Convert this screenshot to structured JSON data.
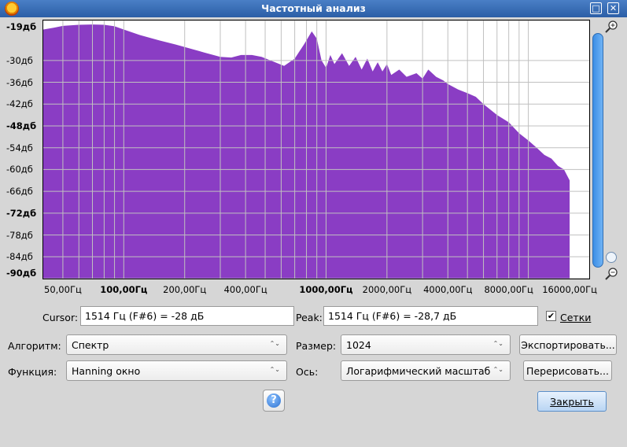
{
  "window": {
    "title": "Частотный анализ",
    "maximize_glyph": "□",
    "close_glyph": "✕"
  },
  "chart_data": {
    "type": "area",
    "title": "",
    "xlabel": "",
    "ylabel": "",
    "x_scale": "log",
    "xlim": [
      40,
      20000
    ],
    "ylim": [
      -90,
      -19
    ],
    "grid": true,
    "fill_color": "#8a3dc4",
    "x_ticks": [
      {
        "value": 50,
        "label": "50,00Гц",
        "bold": false
      },
      {
        "value": 100,
        "label": "100,00Гц",
        "bold": true
      },
      {
        "value": 200,
        "label": "200,00Гц",
        "bold": false
      },
      {
        "value": 400,
        "label": "400,00Гц",
        "bold": false
      },
      {
        "value": 1000,
        "label": "1000,00Гц",
        "bold": true
      },
      {
        "value": 2000,
        "label": "2000,00Гц",
        "bold": false
      },
      {
        "value": 4000,
        "label": "4000,00Гц",
        "bold": false
      },
      {
        "value": 8000,
        "label": "8000,00Гц",
        "bold": false
      },
      {
        "value": 16000,
        "label": "16000,00Гц",
        "bold": false
      }
    ],
    "y_ticks": [
      {
        "value": -19,
        "label": "-19дб",
        "bold": true
      },
      {
        "value": -30,
        "label": "-30дб",
        "bold": false
      },
      {
        "value": -36,
        "label": "-36дб",
        "bold": false
      },
      {
        "value": -42,
        "label": "-42дб",
        "bold": false
      },
      {
        "value": -48,
        "label": "-48дб",
        "bold": true
      },
      {
        "value": -54,
        "label": "-54дб",
        "bold": false
      },
      {
        "value": -60,
        "label": "-60дб",
        "bold": false
      },
      {
        "value": -66,
        "label": "-66дб",
        "bold": false
      },
      {
        "value": -72,
        "label": "-72дб",
        "bold": true
      },
      {
        "value": -78,
        "label": "-78дб",
        "bold": false
      },
      {
        "value": -84,
        "label": "-84дб",
        "bold": false
      },
      {
        "value": -90,
        "label": "-90дб",
        "bold": true
      }
    ],
    "series": [
      {
        "x": [
          40,
          45,
          50,
          60,
          70,
          80,
          90,
          100,
          120,
          150,
          180,
          200,
          250,
          300,
          340,
          380,
          430,
          480,
          560,
          620,
          700,
          780,
          850,
          900,
          950,
          1000,
          1050,
          1100,
          1200,
          1300,
          1400,
          1500,
          1600,
          1700,
          1800,
          1900,
          2000,
          2100,
          2300,
          2500,
          2800,
          3000,
          3200,
          3500,
          3800,
          4000,
          4500,
          5000,
          5500,
          6000,
          7000,
          8000,
          9000,
          10000,
          11000,
          12000,
          13000,
          14000,
          15000,
          16000
        ],
        "values": [
          -21.5,
          -21,
          -20.5,
          -20.2,
          -20.1,
          -20.2,
          -20.6,
          -21.5,
          -23,
          -24.5,
          -25.6,
          -26.3,
          -27.8,
          -29,
          -29.2,
          -28.5,
          -28.5,
          -29,
          -30.5,
          -31.5,
          -29.5,
          -25.5,
          -22,
          -24,
          -30,
          -32,
          -28.5,
          -31,
          -28,
          -31.5,
          -29,
          -32.5,
          -29.5,
          -33,
          -30.5,
          -33,
          -31,
          -34,
          -32.5,
          -34.5,
          -33.5,
          -35,
          -32.5,
          -34.5,
          -35.5,
          -36.5,
          -38,
          -39,
          -40,
          -42,
          -45,
          -47,
          -50,
          -52,
          -54,
          -56,
          -57,
          -59,
          -60,
          -63
        ]
      }
    ]
  },
  "cursor": {
    "label": "Cursor:",
    "value": "1514 Гц (F#6) = -28 дБ"
  },
  "peak": {
    "label": "Peak:",
    "value": "1514 Гц (F#6) = -28,7 дБ"
  },
  "grids": {
    "label": "Сетки",
    "checked": true,
    "check_glyph": "✔"
  },
  "algorithm": {
    "label": "Алгоритм:",
    "value": "Спектр"
  },
  "size": {
    "label": "Размер:",
    "value": "1024"
  },
  "function": {
    "label": "Функция:",
    "value": "Hanning окно"
  },
  "axis": {
    "label": "Ось:",
    "value": "Логарифмический масштаб"
  },
  "buttons": {
    "export": "Экспортировать...",
    "redraw": "Перерисовать...",
    "close": "Закрыть",
    "help": "?"
  },
  "icons": {
    "zoom_in": "zoom-in-icon",
    "zoom_out": "zoom-out-icon",
    "combo_arrow": "⌃⌄"
  }
}
